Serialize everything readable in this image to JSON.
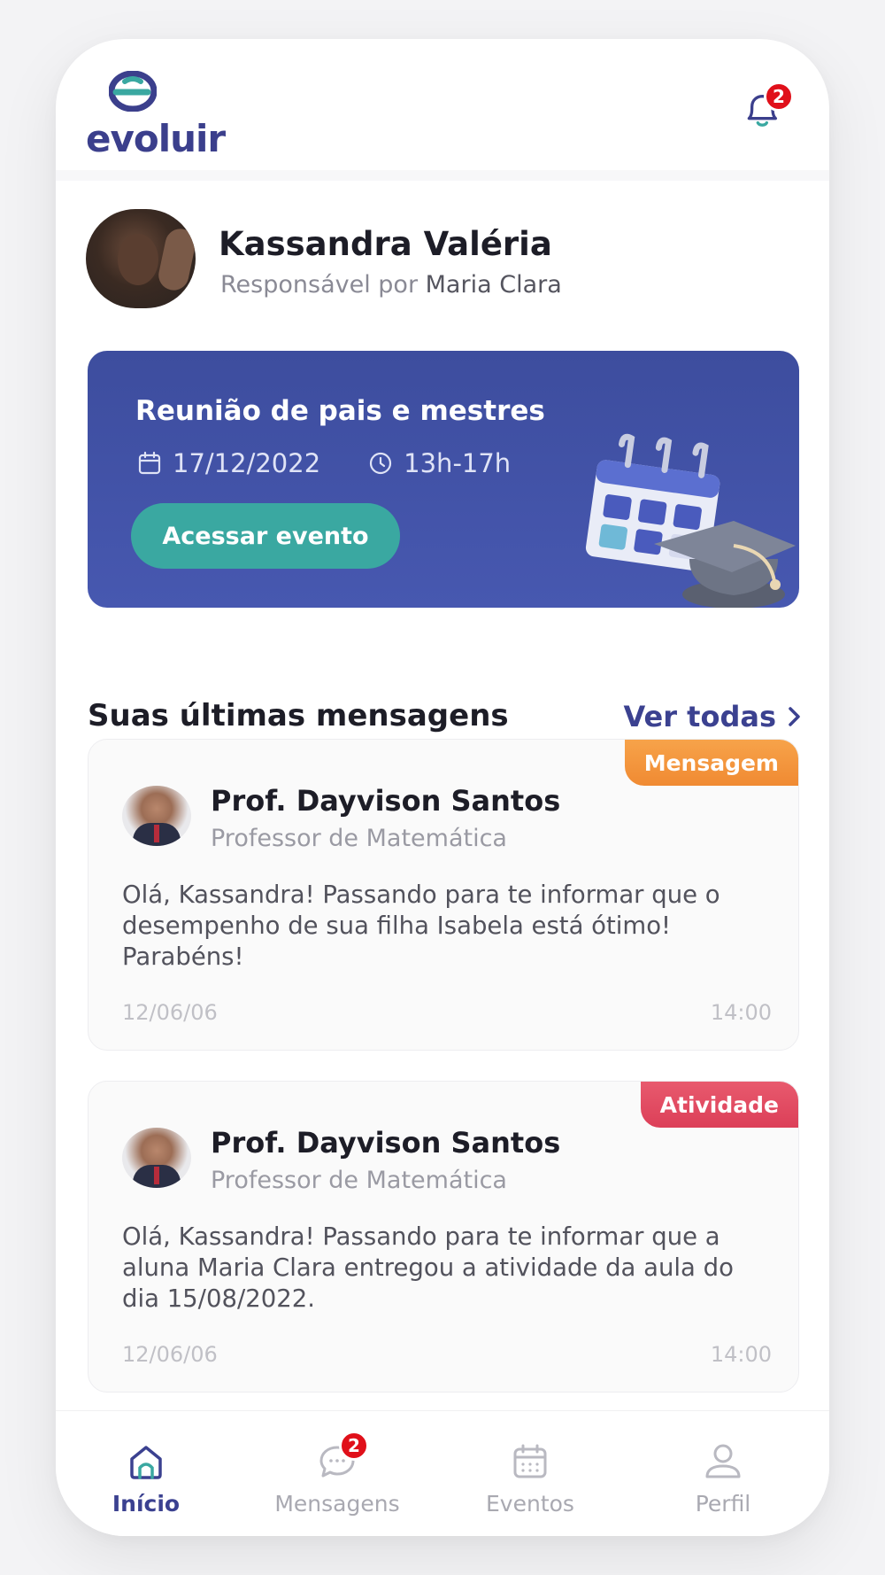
{
  "app": {
    "logo_text": "evoluir",
    "notifications_count": "2",
    "colors": {
      "brand": "#3b3f8c",
      "teal": "#3aa8a1",
      "event_bg": "#4758b0",
      "tag_message": "#f4953b",
      "tag_activity": "#e24a62",
      "badge": "#e0101a"
    }
  },
  "profile": {
    "name": "Kassandra Valéria",
    "subtitle_prefix": "Responsável por",
    "child_name": "Maria Clara"
  },
  "event": {
    "title": "Reunião de pais e mestres",
    "date": "17/12/2022",
    "time": "13h-17h",
    "button_label": "Acessar evento",
    "date_icon": "calendar-icon",
    "time_icon": "clock-icon"
  },
  "messages_section": {
    "title": "Suas últimas mensagens",
    "see_all": "Ver todas"
  },
  "messages": [
    {
      "tag": "Mensagem",
      "sender": "Prof. Dayvison Santos",
      "role": "Professor de Matemática",
      "body": "Olá, Kassandra! Passando para te informar que o desempenho de sua filha Isabela está ótimo! Parabéns!",
      "date": "12/06/06",
      "time": "14:00"
    },
    {
      "tag": "Atividade",
      "sender": "Prof. Dayvison Santos",
      "role": "Professor de Matemática",
      "body": "Olá, Kassandra! Passando para te informar que a aluna Maria Clara entregou a atividade da aula do dia 15/08/2022.",
      "date": "12/06/06",
      "time": "14:00"
    }
  ],
  "bottom_nav": {
    "items": [
      {
        "label": "Início",
        "icon": "home-icon",
        "active": true
      },
      {
        "label": "Mensagens",
        "icon": "chat-icon",
        "badge": "2"
      },
      {
        "label": "Eventos",
        "icon": "calendar-icon"
      },
      {
        "label": "Perfil",
        "icon": "user-icon"
      }
    ]
  }
}
